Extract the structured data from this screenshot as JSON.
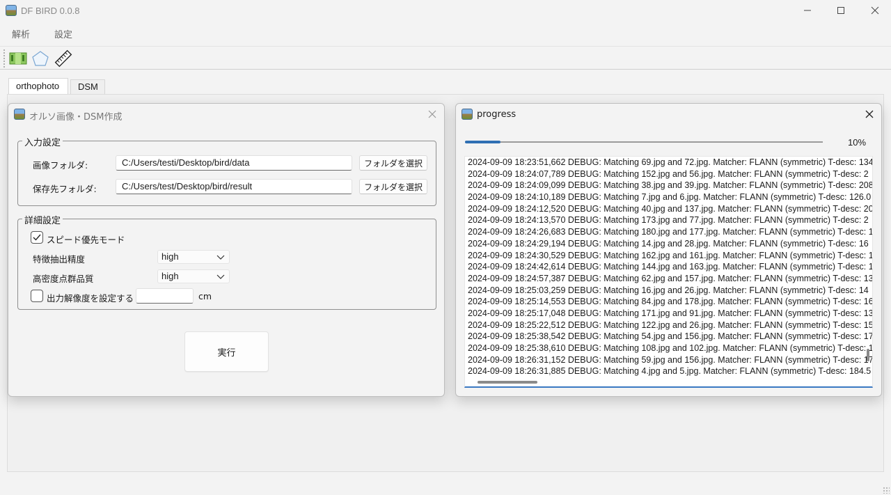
{
  "app": {
    "title": "DF BIRD 0.0.8"
  },
  "window_controls": {
    "minimize": "—",
    "maximize": "☐",
    "close": "✕"
  },
  "menu": {
    "items": [
      "解析",
      "設定"
    ]
  },
  "toolbar": {
    "icons": [
      "ortho-map-icon",
      "polygon-icon",
      "ruler-icon"
    ]
  },
  "tabs": [
    {
      "label": "orthophoto",
      "active": true
    },
    {
      "label": "DSM",
      "active": false
    }
  ],
  "ortho_dialog": {
    "title": "オルソ画像・DSM作成",
    "input_group": {
      "legend": "入力設定",
      "image_folder_label": "画像フォルダ:",
      "image_folder_value": "C:/Users/testi/Desktop/bird/data",
      "save_folder_label": "保存先フォルダ:",
      "save_folder_value": "C:/Users/test/Desktop/bird/result",
      "select_folder_button": "フォルダを選択"
    },
    "detail_group": {
      "legend": "詳細設定",
      "speed_mode_label": "スピード優先モード",
      "speed_mode_checked": true,
      "feature_precision_label": "特徴抽出精度",
      "feature_precision_value": "high",
      "dense_quality_label": "高密度点群品質",
      "dense_quality_value": "high",
      "output_resolution_label": "出力解像度を設定する",
      "output_resolution_checked": false,
      "output_resolution_value": "",
      "output_resolution_unit": "cm"
    },
    "run_button": "実行"
  },
  "progress_dialog": {
    "title": "progress",
    "percent_text": "10%",
    "progress": 0.1,
    "log": [
      "2024-09-09 18:23:51,662 DEBUG: Matching 69.jpg and 72.jpg.  Matcher: FLANN (symmetric) T-desc: 134",
      "2024-09-09 18:24:07,789 DEBUG: Matching 152.jpg and 56.jpg.  Matcher: FLANN (symmetric) T-desc: 2",
      "2024-09-09 18:24:09,099 DEBUG: Matching 38.jpg and 39.jpg.  Matcher: FLANN (symmetric) T-desc: 208",
      "2024-09-09 18:24:10,189 DEBUG: Matching 7.jpg and 6.jpg.  Matcher: FLANN (symmetric) T-desc: 126.0",
      "2024-09-09 18:24:12,520 DEBUG: Matching 40.jpg and 137.jpg.  Matcher: FLANN (symmetric) T-desc: 20",
      "2024-09-09 18:24:13,570 DEBUG: Matching 173.jpg and 77.jpg.  Matcher: FLANN (symmetric) T-desc: 2",
      "2024-09-09 18:24:26,683 DEBUG: Matching 180.jpg and 177.jpg.  Matcher: FLANN (symmetric) T-desc: 1",
      "2024-09-09 18:24:29,194 DEBUG: Matching 14.jpg and 28.jpg.  Matcher: FLANN (symmetric) T-desc: 16",
      "2024-09-09 18:24:30,529 DEBUG: Matching 162.jpg and 161.jpg.  Matcher: FLANN (symmetric) T-desc: 1",
      "2024-09-09 18:24:42,614 DEBUG: Matching 144.jpg and 163.jpg.  Matcher: FLANN (symmetric) T-desc: 1",
      "2024-09-09 18:24:57,387 DEBUG: Matching 62.jpg and 157.jpg.  Matcher: FLANN (symmetric) T-desc: 13",
      "2024-09-09 18:25:03,259 DEBUG: Matching 16.jpg and 26.jpg.  Matcher: FLANN (symmetric) T-desc: 14",
      "2024-09-09 18:25:14,553 DEBUG: Matching 84.jpg and 178.jpg.  Matcher: FLANN (symmetric) T-desc: 16",
      "2024-09-09 18:25:17,048 DEBUG: Matching 171.jpg and 91.jpg.  Matcher: FLANN (symmetric) T-desc: 13",
      "2024-09-09 18:25:22,512 DEBUG: Matching 122.jpg and 26.jpg.  Matcher: FLANN (symmetric) T-desc: 15",
      "2024-09-09 18:25:38,542 DEBUG: Matching 54.jpg and 156.jpg.  Matcher: FLANN (symmetric) T-desc: 17",
      "2024-09-09 18:25:38,610 DEBUG: Matching 108.jpg and 102.jpg.  Matcher: FLANN (symmetric) T-desc: 1",
      "2024-09-09 18:26:31,152 DEBUG: Matching 59.jpg and 156.jpg.  Matcher: FLANN (symmetric) T-desc: 17",
      "2024-09-09 18:26:31,885 DEBUG: Matching 4.jpg and 5.jpg.  Matcher: FLANN (symmetric) T-desc: 184.5"
    ]
  },
  "colors": {
    "accent": "#2f6fb3",
    "window_bg": "#f3f3f3"
  }
}
